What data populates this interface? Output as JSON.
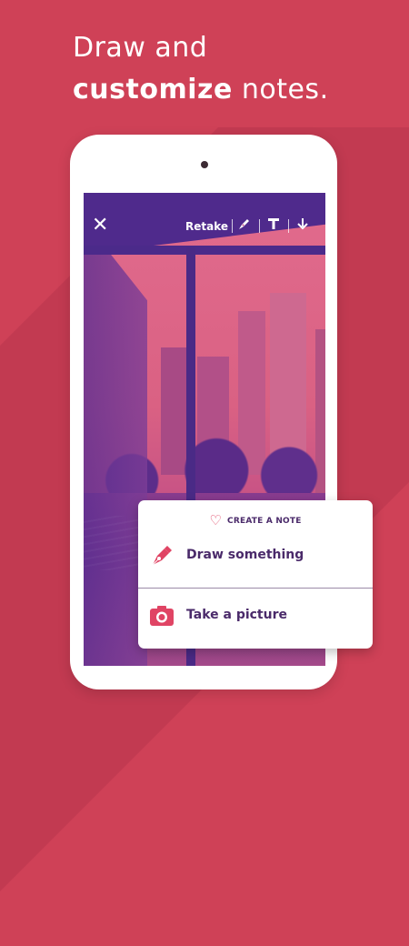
{
  "headline": {
    "line1": "Draw and",
    "line2_bold": "customize",
    "line2_rest": " notes."
  },
  "toolbar": {
    "close": "✕",
    "retake": "Retake",
    "pen_icon": "pen-icon",
    "text_icon": "text-icon",
    "download_icon": "download-icon"
  },
  "menu": {
    "title": "CREATE A NOTE",
    "items": [
      {
        "label": "Draw something",
        "icon": "fountain-pen-icon"
      },
      {
        "label": "Take a picture",
        "icon": "camera-icon"
      }
    ]
  },
  "colors": {
    "background": "#cf4157",
    "accent": "#e04464",
    "menu_text": "#4a2a6a"
  }
}
